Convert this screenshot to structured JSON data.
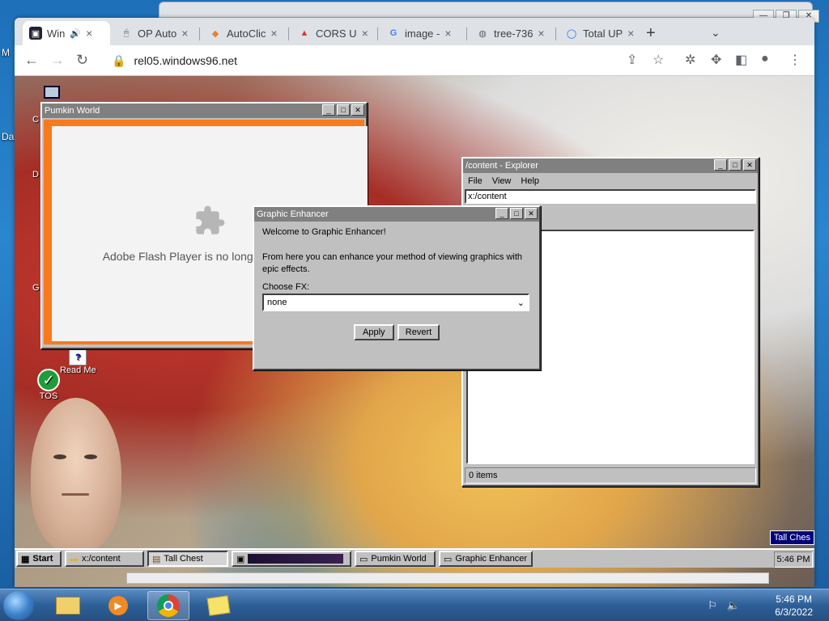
{
  "background_window": {
    "buttons": [
      "—",
      "❐",
      "✕"
    ]
  },
  "chrome": {
    "tabs": [
      {
        "label": "Win",
        "icon": "windows96-favicon",
        "audio": "🔊"
      },
      {
        "label": "OP Auto",
        "icon": "mouse-favicon"
      },
      {
        "label": "AutoClic",
        "icon": "autoclicker-favicon"
      },
      {
        "label": "CORS U",
        "icon": "cors-favicon"
      },
      {
        "label": "image -",
        "icon": "google-favicon"
      },
      {
        "label": "tree-736",
        "icon": "globe-favicon"
      },
      {
        "label": "Total UP",
        "icon": "total-favicon"
      }
    ],
    "url": "rel05.windows96.net",
    "window_buttons": [
      "—",
      "❐",
      "✕"
    ]
  },
  "desktop": {
    "icons": [
      {
        "label": "Read Me"
      },
      {
        "label": "TOS"
      }
    ],
    "edge_labels": [
      "M",
      "Da",
      "C",
      "D",
      "G"
    ]
  },
  "pumkin_window": {
    "title": "Pumkin World",
    "message": "Adobe Flash Player is no longer supported"
  },
  "explorer_window": {
    "title": "/content - Explorer",
    "menu": [
      "File",
      "View",
      "Help"
    ],
    "address": "x:/content",
    "status": "0 items"
  },
  "enhancer_window": {
    "title": "Graphic Enhancer",
    "welcome": "Welcome to Graphic Enhancer!",
    "description": "From here you can enhance your method of viewing graphics with epic effects.",
    "choose_label": "Choose FX:",
    "selected": "none",
    "apply": "Apply",
    "revert": "Revert"
  },
  "w96_taskbar": {
    "start": "Start",
    "tasks": [
      {
        "label": "x:/content"
      },
      {
        "label": "Tall Chest"
      },
      {
        "label": ""
      },
      {
        "label": "Pumkin World"
      },
      {
        "label": "Graphic Enhancer"
      }
    ],
    "clock": "5:46 PM",
    "popup": "Tall Ches"
  },
  "win7": {
    "time": "5:46 PM",
    "date": "6/3/2022"
  },
  "colors": {
    "flash_orange": "#f97a1c",
    "w96_title": "#808080",
    "w96_face": "#c0c0c0"
  }
}
